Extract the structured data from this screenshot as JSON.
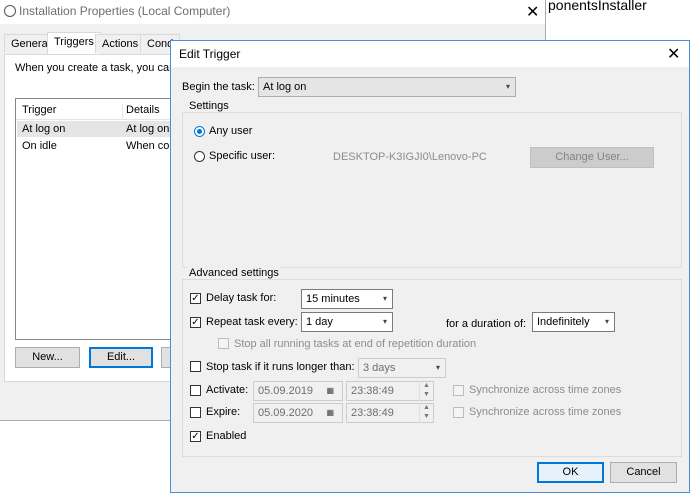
{
  "bg_window": {
    "title": "Installation Properties (Local Computer)",
    "tabs": [
      "General",
      "Triggers",
      "Actions",
      "Cond"
    ],
    "intro_text": "When you create a task, you can s",
    "columns": [
      "Trigger",
      "Details"
    ],
    "rows": [
      {
        "trigger": "At log on",
        "details": "At log on"
      },
      {
        "trigger": "On idle",
        "details": "When cor"
      }
    ],
    "buttons": {
      "new": "New...",
      "edit": "Edit..."
    },
    "behind_text_1": "ponentsInstaller"
  },
  "dialog": {
    "title": "Edit Trigger",
    "begin_label": "Begin the task:",
    "begin_value": "At log on",
    "settings_label": "Settings",
    "any_user": "Any user",
    "specific_user": "Specific user:",
    "user_name": "DESKTOP-K3IGJI0\\Lenovo-PC",
    "change_user": "Change User...",
    "advanced_label": "Advanced settings",
    "delay_label": "Delay task for:",
    "delay_value": "15 minutes",
    "repeat_label": "Repeat task every:",
    "repeat_value": "1 day",
    "duration_label": "for a duration of:",
    "duration_value": "Indefinitely",
    "stop_all_label": "Stop all running tasks at end of repetition duration",
    "stop_longer_label": "Stop task if it runs longer than:",
    "stop_longer_value": "3 days",
    "activate_label": "Activate:",
    "activate_date": "05.09.2019",
    "activate_time": "23:38:49",
    "expire_label": "Expire:",
    "expire_date": "05.09.2020",
    "expire_time": "23:38:49",
    "sync_label": "Synchronize across time zones",
    "enabled_label": "Enabled",
    "ok": "OK",
    "cancel": "Cancel"
  },
  "colors": {
    "accent": "#0078d7",
    "dialog_border": "#4a90d9"
  }
}
